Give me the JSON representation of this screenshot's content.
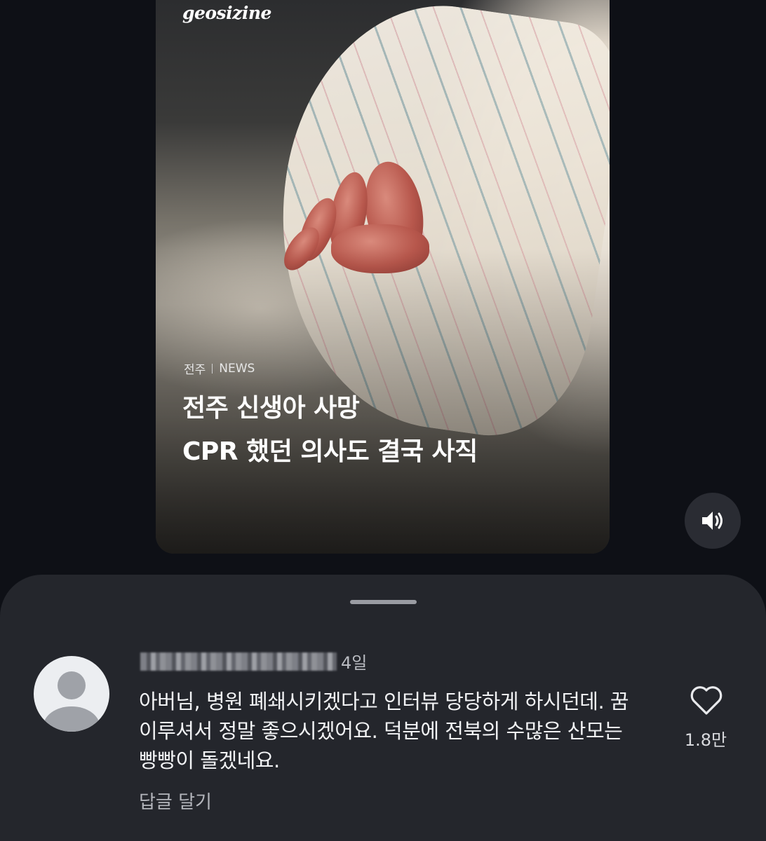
{
  "video_card": {
    "brand": "geosizine",
    "category": "전주",
    "section": "NEWS",
    "headline_line1": "전주 신생아 사망",
    "headline_line2": "CPR 했던 의사도 결국 사직",
    "image_description_icon": "newborn-foot-photo"
  },
  "controls": {
    "volume_icon": "speaker-volume-icon"
  },
  "comments": {
    "handle_icon": "drag-handle",
    "items": [
      {
        "avatar_icon": "default-avatar-icon",
        "username_blurred": true,
        "time": "4일",
        "text": "아버님, 병원 폐쇄시키겠다고 인터뷰 당당하게 하시던데. 꿈 이루셔서 정말 좋으시겠어요. 덕분에 전북의 수많은 산모는 빵빵이 돌겠네요.",
        "reply_label": "답글 달기",
        "like_icon": "heart-icon",
        "like_count": "1.8만"
      }
    ]
  },
  "colors": {
    "background": "#0e1016",
    "sheet": "#24262c",
    "text_primary": "#f2f3f5",
    "text_secondary": "#b4b6bc"
  }
}
